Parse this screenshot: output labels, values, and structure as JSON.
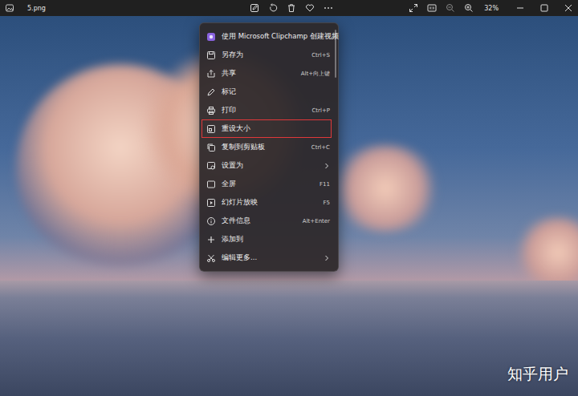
{
  "window": {
    "title": "5.png"
  },
  "toolbar": {
    "zoom": "32%"
  },
  "context_menu": {
    "items": [
      {
        "label": "使用 Microsoft Clipchamp 创建视频",
        "submenu": false,
        "annotated": false
      },
      {
        "label": "另存为",
        "shortcut": "Ctrl+S",
        "submenu": false,
        "annotated": false
      },
      {
        "label": "共享",
        "shortcut": "Alt+向上键",
        "submenu": false,
        "annotated": false
      },
      {
        "label": "标记",
        "submenu": false,
        "annotated": false
      },
      {
        "label": "打印",
        "shortcut": "Ctrl+P",
        "submenu": false,
        "annotated": false
      },
      {
        "label": "重设大小",
        "submenu": false,
        "annotated": true
      },
      {
        "label": "复制到剪贴板",
        "shortcut": "Ctrl+C",
        "submenu": false,
        "annotated": false
      },
      {
        "label": "设置为",
        "submenu": true,
        "annotated": false
      },
      {
        "label": "全屏",
        "shortcut": "F11",
        "submenu": false,
        "annotated": false
      },
      {
        "label": "幻灯片放映",
        "shortcut": "F5",
        "submenu": false,
        "annotated": false
      },
      {
        "label": "文件信息",
        "shortcut": "Alt+Enter",
        "submenu": false,
        "annotated": false
      },
      {
        "label": "添加到",
        "submenu": false,
        "annotated": false
      },
      {
        "label": "编辑更多...",
        "submenu": true,
        "annotated": false
      }
    ]
  },
  "watermark": "知乎用户"
}
